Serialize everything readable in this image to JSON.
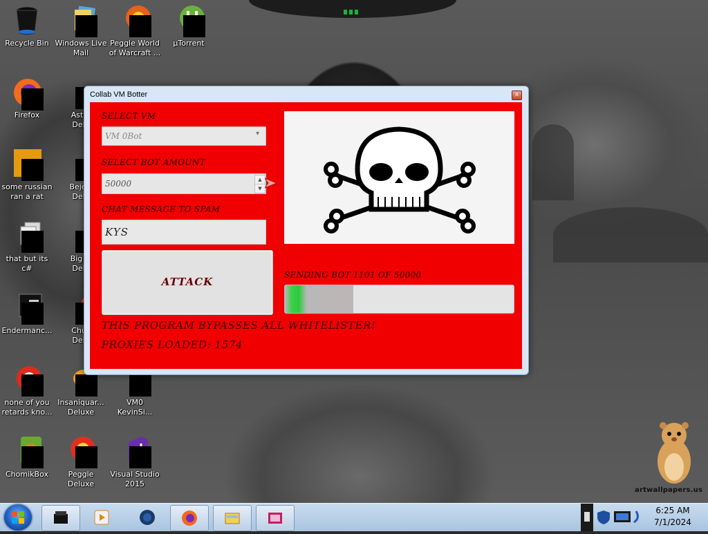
{
  "desktop": {
    "watermark": "artwallpapers.us",
    "icons": [
      {
        "label": "Recycle Bin",
        "icon": "recycle-bin-icon"
      },
      {
        "label": "Windows Live\nMail",
        "icon": "windows-live-mail-icon"
      },
      {
        "label": "Peggle World\nof Warcraft ...",
        "icon": "peggle-world-of-warcraft-icon"
      },
      {
        "label": "µTorrent",
        "icon": "utorrent-icon"
      },
      {
        "label": "Firefox",
        "icon": "firefox-icon"
      },
      {
        "label": "Astro\nDelu",
        "icon": "astro-deluxe-icon"
      },
      {
        "label": "some russian\nran a rat",
        "icon": "russian-rat-icon"
      },
      {
        "label": "Bejew\nDelu",
        "icon": "bejeweled-deluxe-icon"
      },
      {
        "label": "that but its c#",
        "icon": "that-but-its-csharp-icon"
      },
      {
        "label": "Big M\nDelu",
        "icon": "big-money-deluxe-icon"
      },
      {
        "label": "Endermanc...",
        "icon": "endermanch-icon"
      },
      {
        "label": "Chuz\nDelu",
        "icon": "chuzzle-deluxe-icon"
      },
      {
        "label": "none of you\nretards kno...",
        "icon": "none-of-you-icon"
      },
      {
        "label": "Insaniquar...\nDeluxe",
        "icon": "insaniquarium-deluxe-icon"
      },
      {
        "label": "VM0\nKevinSi...",
        "icon": "vm0-kevinsi-icon"
      },
      {
        "label": "ChomikBox",
        "icon": "chomikbox-icon"
      },
      {
        "label": "Peggle Deluxe",
        "icon": "peggle-deluxe-icon"
      },
      {
        "label": "Visual Studio\n2015",
        "icon": "visual-studio-2015-icon"
      }
    ]
  },
  "window": {
    "title": "Collab VM Botter",
    "close_symbol": "x",
    "select_vm_label": "SELECT VM",
    "select_vm_value": "VM 0Bot",
    "bot_amount_label": "SELECT BOT AMOUNT",
    "bot_amount_value": "50000",
    "chat_label": "CHAT MESSAGE TO SPAM",
    "chat_value": "KYS",
    "attack_label": "ATTACK",
    "status_text": "SENDING BOT 1101 OF 50000",
    "progress_fraction": 0.3,
    "bypass_text": "THIS PROGRAM BYPASSES ALL WHITELISTER!",
    "proxies_text": "PROXIES LOADED: 1574",
    "image_icon": "skull-and-crossbones-icon"
  },
  "taskbar": {
    "start_icon": "windows-start-icon",
    "pinned": [
      "task-manager-icon",
      "media-player-icon",
      "network-globe-icon",
      "firefox-icon",
      "file-explorer-icon",
      "media-center-icon"
    ],
    "clock_time": "6:25 AM",
    "clock_date": "7/1/2024"
  },
  "colors": {
    "client_bg": "#f00000",
    "taskbar": "#b6cde6",
    "progress_green": "#2cc93c"
  }
}
